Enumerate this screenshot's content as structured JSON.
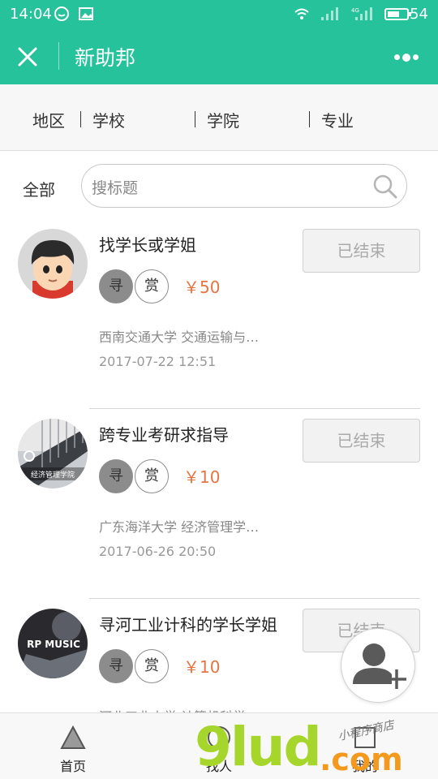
{
  "status_bar": {
    "time": "14:04",
    "battery": "54",
    "icons": [
      "wechat-bubble-icon",
      "image-icon",
      "wifi-icon",
      "signal-icon",
      "4g-signal-icon",
      "battery-icon"
    ]
  },
  "header": {
    "title": "新助邦",
    "close_icon": "close-icon",
    "more_icon": "more-icon",
    "background": "#26c29b"
  },
  "filters": [
    {
      "label": "地区"
    },
    {
      "label": "学校"
    },
    {
      "label": "学院"
    },
    {
      "label": "专业"
    }
  ],
  "search": {
    "scope_label": "全部",
    "placeholder": "搜标题"
  },
  "tasks": [
    {
      "title": "找学长或学姐",
      "status": "已结束",
      "tag1": "寻",
      "tag2": "赏",
      "reward": "￥50",
      "school": "西南交通大学 交通运输与…",
      "date": "2017-07-22 12:51"
    },
    {
      "title": "跨专业考研求指导",
      "status": "已结束",
      "tag1": "寻",
      "tag2": "赏",
      "reward": "￥10",
      "school": "广东海洋大学 经济管理学…",
      "date": "2017-06-26 20:50",
      "avatar_caption": "经济管理学院"
    },
    {
      "title": "寻河工业计科的学长学姐",
      "status": "已结束",
      "tag1": "寻",
      "tag2": "赏",
      "reward": "￥10",
      "school": "河北工业大学 计算机科学",
      "avatar_caption": "RP MUSIC"
    }
  ],
  "bottom_nav": [
    {
      "label": "首页",
      "icon": "home-triangle-icon"
    },
    {
      "label": "找人",
      "icon": "find-person-icon"
    },
    {
      "label": "我的",
      "icon": "profile-icon"
    }
  ],
  "fab": {
    "icon": "add-user-icon"
  },
  "watermark": {
    "brand_num": "9lud",
    "brand_domain": ".com",
    "small_text": "小程序商店"
  },
  "colors": {
    "brand": "#26c29b",
    "reward": "#e67442",
    "watermark_green": "#a6d62b",
    "watermark_orange": "#f39a1e"
  }
}
